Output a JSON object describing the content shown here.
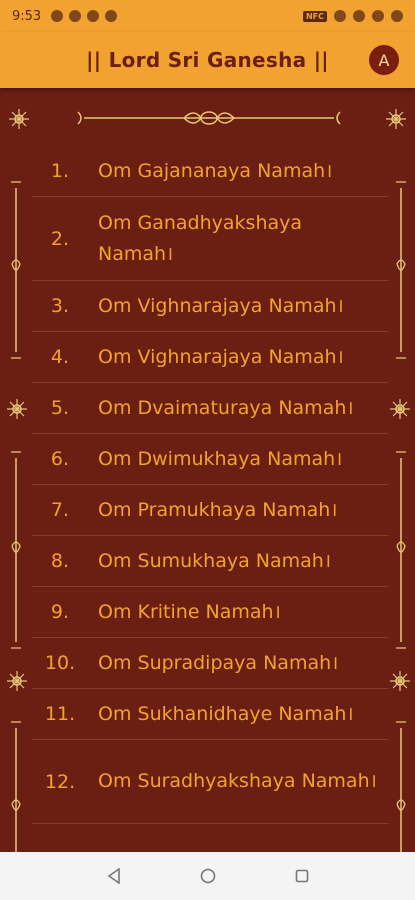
{
  "status_bar": {
    "time": "9:53"
  },
  "app_bar": {
    "title": "|| Lord Sri Ganesha ||",
    "avatar_letter": "A"
  },
  "names": [
    {
      "number": "1.",
      "text": "Om Gajananaya Namah।"
    },
    {
      "number": "2.",
      "text": "Om Ganadhyakshaya Namah।"
    },
    {
      "number": "3.",
      "text": "Om Vighnarajaya Namah।"
    },
    {
      "number": "4.",
      "text": "Om Vighnarajaya Namah।"
    },
    {
      "number": "5.",
      "text": "Om Dvaimaturaya Namah।"
    },
    {
      "number": "6.",
      "text": "Om Dwimukhaya Namah।"
    },
    {
      "number": "7.",
      "text": "Om Pramukhaya Namah।"
    },
    {
      "number": "8.",
      "text": "Om Sumukhaya Namah।"
    },
    {
      "number": "9.",
      "text": "Om Kritine Namah।"
    },
    {
      "number": "10.",
      "text": "Om Supradipaya Namah।"
    },
    {
      "number": "11.",
      "text": "Om Sukhanidhaye Namah।"
    },
    {
      "number": "12.",
      "text": "Om Suradhyakshaya Namah।"
    }
  ],
  "colors": {
    "background": "#6b1f13",
    "accent": "#f2a230",
    "ornament": "#e8c878"
  },
  "icons": {
    "back": "triangle-back-icon",
    "home": "circle-home-icon",
    "recents": "square-recents-icon"
  }
}
